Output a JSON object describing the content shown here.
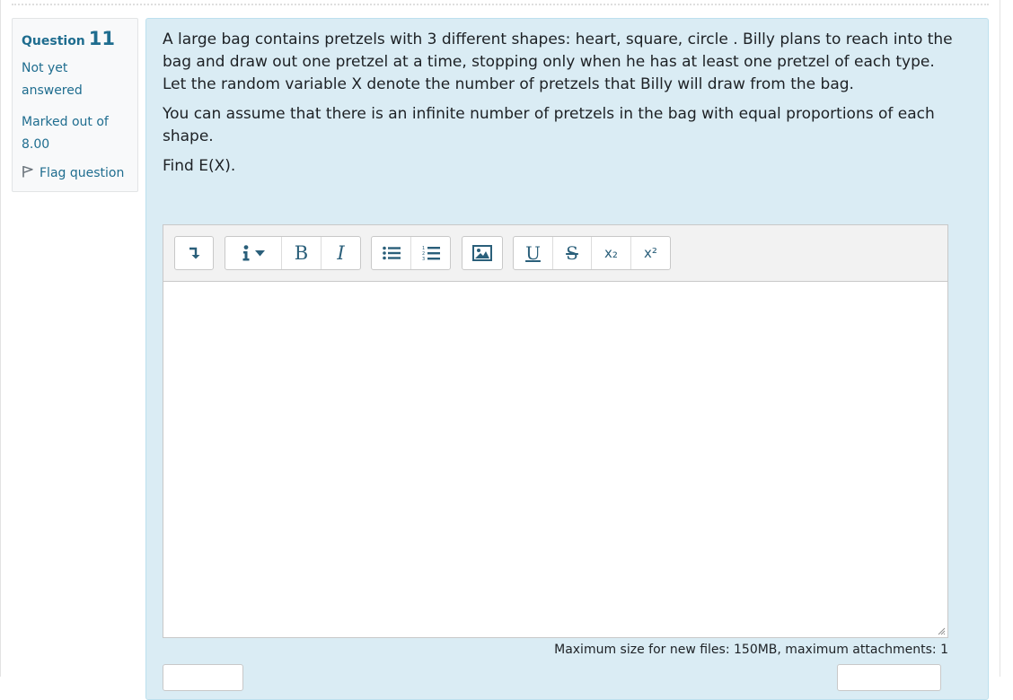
{
  "question": {
    "label": "Question",
    "number": "11",
    "state": "Not yet answered",
    "grade": "Marked out of 8.00",
    "flag_label": "Flag question"
  },
  "qtext": {
    "p1": "A large bag contains pretzels with 3 different shapes: heart, square, circle . Billy plans to reach into the bag and draw out one pretzel at a time, stopping only when he has at least one pretzel of each type. Let the random variable X denote the number of pretzels that Billy will draw from the bag.",
    "p2": "You can assume that there is an infinite number of pretzels in the bag with equal proportions of each shape.",
    "p3": "Find E(X)."
  },
  "toolbar": {
    "bold": "B",
    "italic": "I",
    "underline": "U",
    "strike": "S",
    "subscript": "x₂",
    "superscript": "x²",
    "icons": [
      "collapse-icon",
      "info-style-icon",
      "bold-icon",
      "italic-icon",
      "bullet-list-icon",
      "numbered-list-icon",
      "image-icon",
      "underline-icon",
      "strikethrough-icon",
      "subscript-icon",
      "superscript-icon"
    ]
  },
  "filepicker": {
    "note": "Maximum size for new files: 150MB, maximum attachments: 1"
  },
  "colors": {
    "accent": "#1f6d8f",
    "content_bg": "#daecf4",
    "toolbar_icon": "#2a5f7a"
  }
}
